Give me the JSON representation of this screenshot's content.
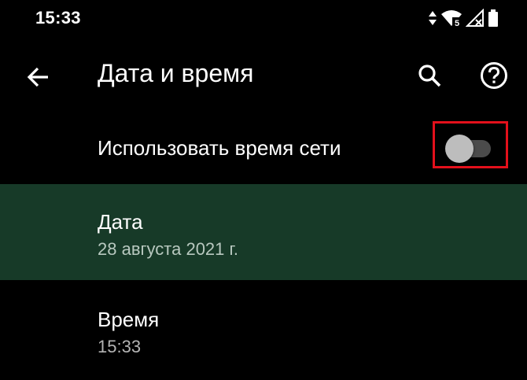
{
  "status_bar": {
    "time": "15:33",
    "icons": [
      "data-arrows-icon",
      "wifi-icon",
      "signal-icon",
      "battery-icon"
    ],
    "wifi_badge": "5"
  },
  "app_bar": {
    "title": "Дата и время",
    "icons": [
      "back-arrow-icon",
      "search-icon",
      "help-icon"
    ]
  },
  "settings": {
    "network_time": {
      "label": "Использовать время сети",
      "enabled": false
    },
    "date": {
      "label": "Дата",
      "value": "28 августа 2021 г."
    },
    "time": {
      "label": "Время",
      "value": "15:33"
    }
  },
  "colors": {
    "background": "#000000",
    "highlight_row": "#173a28",
    "highlight_box": "#e3101b",
    "toggle_track_off": "#4b4b4b",
    "toggle_thumb_off": "#bdbdbd"
  }
}
